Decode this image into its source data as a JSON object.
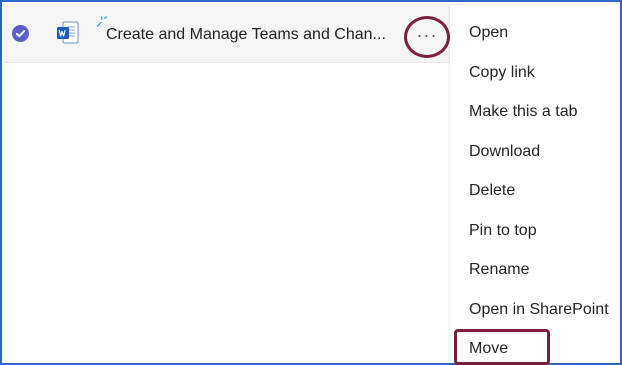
{
  "file_row": {
    "name": "Create and Manage Teams and Chan...",
    "selected": true,
    "icon": "word-document-icon",
    "status_icon": "recent-sparkle-icon",
    "more_options_label": "···"
  },
  "context_menu": {
    "items": [
      {
        "label": "Open"
      },
      {
        "label": "Copy link"
      },
      {
        "label": "Make this a tab"
      },
      {
        "label": "Download"
      },
      {
        "label": "Delete"
      },
      {
        "label": "Pin to top"
      },
      {
        "label": "Rename"
      },
      {
        "label": "Open in SharePoint"
      },
      {
        "label": "Move"
      }
    ]
  },
  "colors": {
    "frame_border": "#2f67c9",
    "selected_check": "#5b5fc7",
    "highlight_annotation": "#7a1f3d",
    "word_blue": "#185abd"
  }
}
